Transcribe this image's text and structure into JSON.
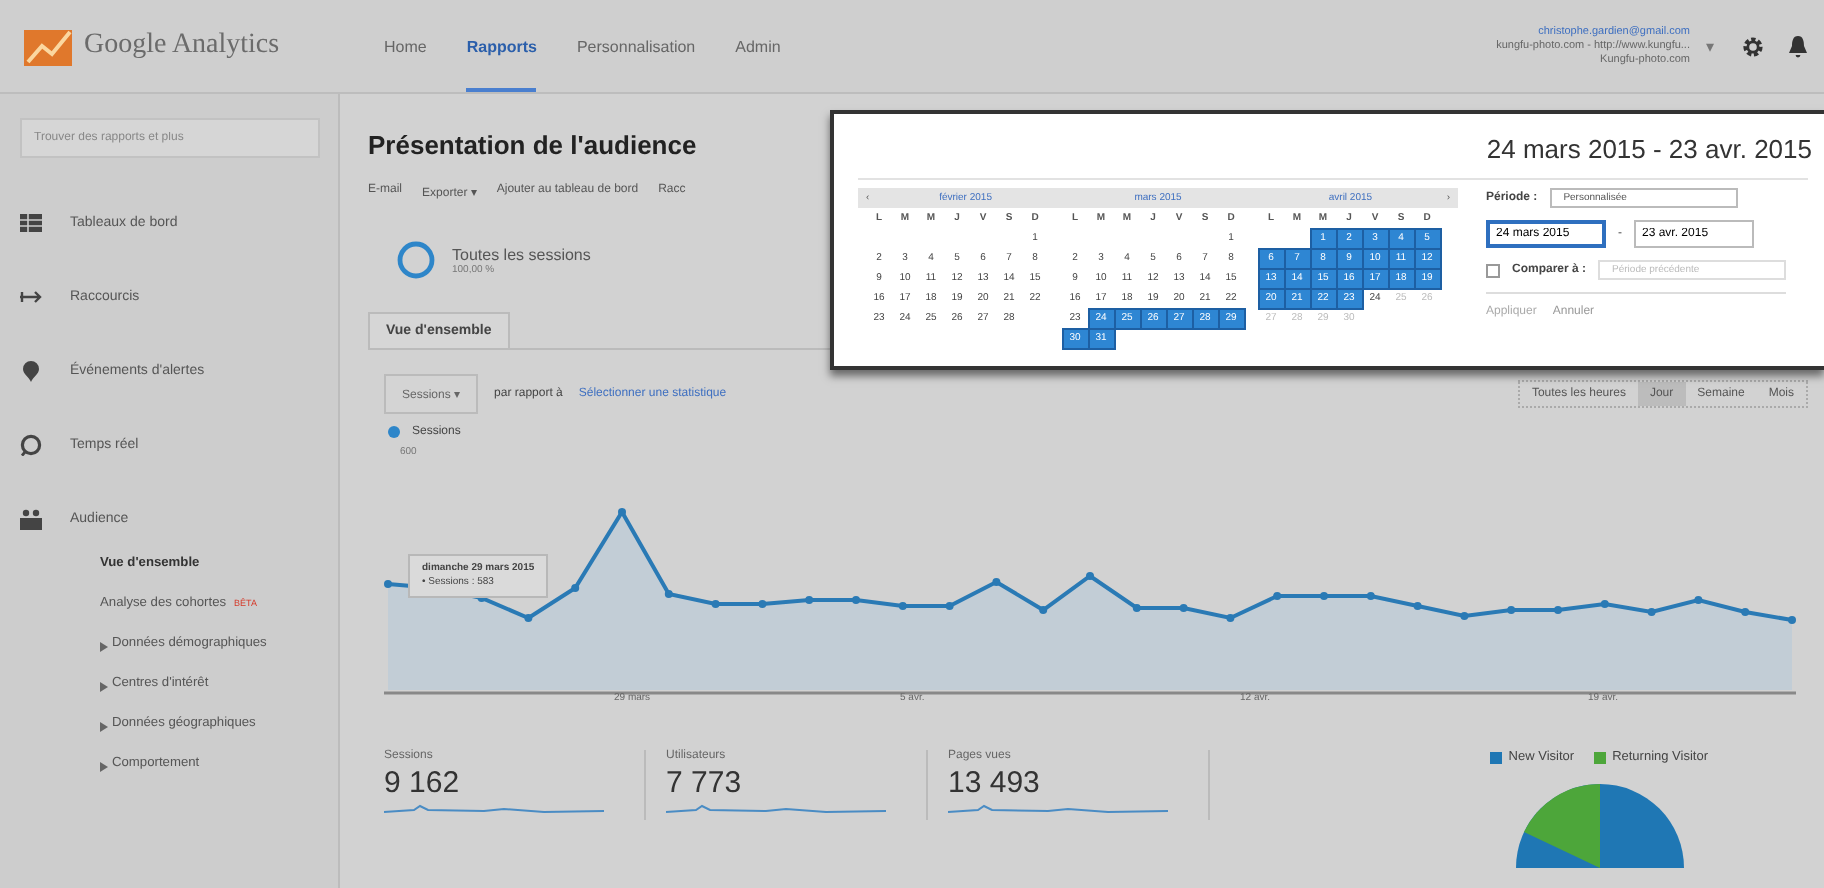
{
  "header": {
    "logo_text": "Google Analytics",
    "nav": [
      {
        "label": "Home",
        "selected": false
      },
      {
        "label": "Rapports",
        "selected": true
      },
      {
        "label": "Personnalisation",
        "selected": false
      },
      {
        "label": "Admin",
        "selected": false
      }
    ],
    "account": {
      "email": "christophe.gardien@gmail.com",
      "property": "kungfu-photo.com - http://www.kungfu...",
      "view": "Kungfu-photo.com",
      "caret": "▾"
    }
  },
  "sidebar": {
    "search": {
      "placeholder": "Trouver des rapports et plus"
    },
    "items": [
      {
        "label": "Tableaux de bord",
        "selected": false
      },
      {
        "label": "Raccourcis",
        "selected": false
      },
      {
        "label": "Événements d'alertes",
        "selected": false
      },
      {
        "label": "Temps réel",
        "selected": false
      },
      {
        "label": "Audience",
        "selected": false,
        "children": [
          {
            "label": "Vue d'ensemble",
            "selected": true,
            "expandable": false
          },
          {
            "label": "Analyse des cohortes",
            "badge": "BÊTA",
            "selected": false,
            "expandable": false
          },
          {
            "label": "Données démographiques",
            "selected": false,
            "expandable": true
          },
          {
            "label": "Centres d'intérêt",
            "selected": false,
            "expandable": true
          },
          {
            "label": "Données géographiques",
            "selected": false,
            "expandable": true
          },
          {
            "label": "Comportement",
            "selected": false,
            "expandable": true
          }
        ]
      }
    ]
  },
  "main": {
    "title": "Présentation de l'audience",
    "toolbar": [
      "E-mail",
      "Exporter ▾",
      "Ajouter au tableau de bord",
      "Racc"
    ],
    "segment": {
      "name": "Toutes les sessions",
      "share": "100,00 %"
    },
    "tabs": [
      {
        "label": "Vue d'ensemble",
        "selected": true
      }
    ],
    "metric_dropdown": "Sessions ▾",
    "compare_label": "par rapport à",
    "compare_link": "Sélectionner une statistique",
    "granularity": [
      {
        "label": "Toutes les heures",
        "selected": false
      },
      {
        "label": "Jour",
        "selected": true
      },
      {
        "label": "Semaine",
        "selected": false
      },
      {
        "label": "Mois",
        "selected": false
      }
    ],
    "chart": {
      "legend": "Sessions",
      "y_label": "600",
      "x_labels": [
        "29 mars",
        "5 avr.",
        "12 avr.",
        "19 avr."
      ],
      "tooltip": {
        "date": "dimanche 29 mars 2015",
        "value": "• Sessions : 583"
      }
    },
    "metrics": [
      {
        "label": "Sessions",
        "value": "9 162"
      },
      {
        "label": "Utilisateurs",
        "value": "7 773"
      },
      {
        "label": "Pages vues",
        "value": "13 493"
      }
    ],
    "pie": {
      "legend": [
        {
          "label": "New Visitor",
          "color": "#1f77b4"
        },
        {
          "label": "Returning Visitor",
          "color": "#4da63a"
        }
      ]
    }
  },
  "datepicker": {
    "range": "24 mars 2015 - 23 avr. 2015",
    "prev": "‹",
    "next": "›",
    "months": [
      {
        "name": "février 2015",
        "weekdays": [
          "L",
          "M",
          "M",
          "J",
          "V",
          "S",
          "D"
        ],
        "days": [
          {
            "n": "1",
            "selected": false,
            "disabled": false
          },
          {
            "n": "2",
            "selected": false,
            "disabled": false
          },
          {
            "n": "3",
            "selected": false,
            "disabled": false
          },
          {
            "n": "4",
            "selected": false,
            "disabled": false
          },
          {
            "n": "5",
            "selected": false,
            "disabled": false
          },
          {
            "n": "6",
            "selected": false,
            "disabled": false
          },
          {
            "n": "7",
            "selected": false,
            "disabled": false
          },
          {
            "n": "8",
            "selected": false,
            "disabled": false
          },
          {
            "n": "9",
            "selected": false,
            "disabled": false
          },
          {
            "n": "10",
            "selected": false,
            "disabled": false
          },
          {
            "n": "11",
            "selected": false,
            "disabled": false
          },
          {
            "n": "12",
            "selected": false,
            "disabled": false
          },
          {
            "n": "13",
            "selected": false,
            "disabled": false
          },
          {
            "n": "14",
            "selected": false,
            "disabled": false
          },
          {
            "n": "15",
            "selected": false,
            "disabled": false
          },
          {
            "n": "16",
            "selected": false,
            "disabled": false
          },
          {
            "n": "17",
            "selected": false,
            "disabled": false
          },
          {
            "n": "18",
            "selected": false,
            "disabled": false
          },
          {
            "n": "19",
            "selected": false,
            "disabled": false
          },
          {
            "n": "20",
            "selected": false,
            "disabled": false
          },
          {
            "n": "21",
            "selected": false,
            "disabled": false
          },
          {
            "n": "22",
            "selected": false,
            "disabled": false
          },
          {
            "n": "23",
            "selected": false,
            "disabled": false
          },
          {
            "n": "24",
            "selected": false,
            "disabled": false
          },
          {
            "n": "25",
            "selected": false,
            "disabled": false
          },
          {
            "n": "26",
            "selected": false,
            "disabled": false
          },
          {
            "n": "27",
            "selected": false,
            "disabled": false
          },
          {
            "n": "28",
            "selected": false,
            "disabled": false
          }
        ]
      },
      {
        "name": "mars 2015",
        "weekdays": [
          "L",
          "M",
          "M",
          "J",
          "V",
          "S",
          "D"
        ],
        "days": [
          {
            "n": "1",
            "selected": false,
            "disabled": false
          },
          {
            "n": "2",
            "selected": false,
            "disabled": false
          },
          {
            "n": "3",
            "selected": false,
            "disabled": false
          },
          {
            "n": "4",
            "selected": false,
            "disabled": false
          },
          {
            "n": "5",
            "selected": false,
            "disabled": false
          },
          {
            "n": "6",
            "selected": false,
            "disabled": false
          },
          {
            "n": "7",
            "selected": false,
            "disabled": false
          },
          {
            "n": "8",
            "selected": false,
            "disabled": false
          },
          {
            "n": "9",
            "selected": false,
            "disabled": false
          },
          {
            "n": "10",
            "selected": false,
            "disabled": false
          },
          {
            "n": "11",
            "selected": false,
            "disabled": false
          },
          {
            "n": "12",
            "selected": false,
            "disabled": false
          },
          {
            "n": "13",
            "selected": false,
            "disabled": false
          },
          {
            "n": "14",
            "selected": false,
            "disabled": false
          },
          {
            "n": "15",
            "selected": false,
            "disabled": false
          },
          {
            "n": "16",
            "selected": false,
            "disabled": false
          },
          {
            "n": "17",
            "selected": false,
            "disabled": false
          },
          {
            "n": "18",
            "selected": false,
            "disabled": false
          },
          {
            "n": "19",
            "selected": false,
            "disabled": false
          },
          {
            "n": "20",
            "selected": false,
            "disabled": false
          },
          {
            "n": "21",
            "selected": false,
            "disabled": false
          },
          {
            "n": "22",
            "selected": false,
            "disabled": false
          },
          {
            "n": "23",
            "selected": false,
            "disabled": false
          },
          {
            "n": "24",
            "selected": true,
            "disabled": false
          },
          {
            "n": "25",
            "selected": true,
            "disabled": false
          },
          {
            "n": "26",
            "selected": true,
            "disabled": false
          },
          {
            "n": "27",
            "selected": true,
            "disabled": false
          },
          {
            "n": "28",
            "selected": true,
            "disabled": false
          },
          {
            "n": "29",
            "selected": true,
            "disabled": false
          },
          {
            "n": "30",
            "selected": true,
            "disabled": false
          },
          {
            "n": "31",
            "selected": true,
            "disabled": false
          }
        ]
      },
      {
        "name": "avril 2015",
        "weekdays": [
          "L",
          "M",
          "M",
          "J",
          "V",
          "S",
          "D"
        ],
        "days": [
          {
            "n": "1",
            "selected": true,
            "disabled": false
          },
          {
            "n": "2",
            "selected": true,
            "disabled": false
          },
          {
            "n": "3",
            "selected": true,
            "disabled": false
          },
          {
            "n": "4",
            "selected": true,
            "disabled": false
          },
          {
            "n": "5",
            "selected": true,
            "disabled": false
          },
          {
            "n": "6",
            "selected": true,
            "disabled": false
          },
          {
            "n": "7",
            "selected": true,
            "disabled": false
          },
          {
            "n": "8",
            "selected": true,
            "disabled": false
          },
          {
            "n": "9",
            "selected": true,
            "disabled": false
          },
          {
            "n": "10",
            "selected": true,
            "disabled": false
          },
          {
            "n": "11",
            "selected": true,
            "disabled": false
          },
          {
            "n": "12",
            "selected": true,
            "disabled": false
          },
          {
            "n": "13",
            "selected": true,
            "disabled": false
          },
          {
            "n": "14",
            "selected": true,
            "disabled": false
          },
          {
            "n": "15",
            "selected": true,
            "disabled": false
          },
          {
            "n": "16",
            "selected": true,
            "disabled": false
          },
          {
            "n": "17",
            "selected": true,
            "disabled": false
          },
          {
            "n": "18",
            "selected": true,
            "disabled": false
          },
          {
            "n": "19",
            "selected": true,
            "disabled": false
          },
          {
            "n": "20",
            "selected": true,
            "disabled": false
          },
          {
            "n": "21",
            "selected": true,
            "disabled": false
          },
          {
            "n": "22",
            "selected": true,
            "disabled": false
          },
          {
            "n": "23",
            "selected": true,
            "disabled": false
          },
          {
            "n": "24",
            "selected": false,
            "disabled": false
          },
          {
            "n": "25",
            "selected": false,
            "disabled": true
          },
          {
            "n": "26",
            "selected": false,
            "disabled": true
          },
          {
            "n": "27",
            "selected": false,
            "disabled": true
          },
          {
            "n": "28",
            "selected": false,
            "disabled": true
          },
          {
            "n": "29",
            "selected": false,
            "disabled": true
          },
          {
            "n": "30",
            "selected": false,
            "disabled": true
          }
        ]
      }
    ],
    "period_label": "Période :",
    "period_value": "Personnalisée",
    "start": "24 mars 2015",
    "separator": "-",
    "end": "23 avr. 2015",
    "compare": {
      "label": "Comparer à :",
      "checked": false,
      "value": "Période précédente"
    },
    "apply": "Appliquer",
    "cancel": "Annuler"
  }
}
